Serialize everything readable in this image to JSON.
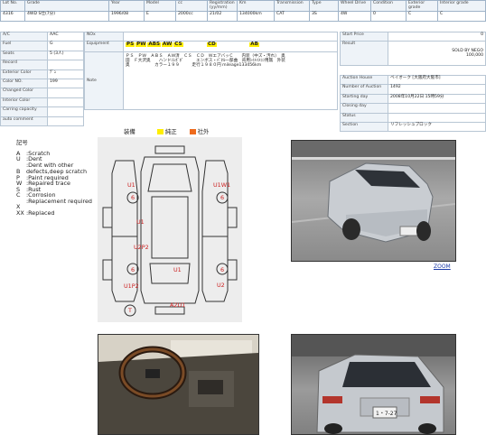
{
  "header": {
    "columns": [
      "Lot No.",
      "Grade",
      "Year",
      "Model",
      "cc",
      "Registration (yy/mm)",
      "Km",
      "Transmission",
      "Type",
      "Wheel Drive",
      "Condition",
      "Exterior grade",
      "Interior grade"
    ],
    "values": [
      "4316",
      "4WD S仕(7分)",
      "1996/08",
      "E",
      "2000cc",
      "21/02",
      "134000km",
      "CAT",
      "3S",
      "4W",
      "0",
      "C",
      "C"
    ]
  },
  "left_rows": [
    {
      "label": "A/C",
      "value": "AAC"
    },
    {
      "label": "Fuel",
      "value": "G"
    },
    {
      "label": "Seats",
      "value": "5 (3人)"
    },
    {
      "label": "Record",
      "value": ""
    },
    {
      "label": "Exterior Color",
      "value": "ﾃﾞｭ"
    },
    {
      "label": "Color NO.",
      "value": "199"
    },
    {
      "label": "Changed Color",
      "value": ""
    },
    {
      "label": "Interior Color",
      "value": ""
    },
    {
      "label": "Carring capacity",
      "value": ""
    },
    {
      "label": "auto comment",
      "value": ""
    }
  ],
  "mid": {
    "nox_label": "NOx",
    "equipment_label": "Equipment",
    "note_label": "Note",
    "equipment_tags": [
      "PS",
      "PW",
      "ABS",
      "AW",
      "CS",
      "CD",
      "AB"
    ],
    "equipment_text": "ＰＳ　ＰＷ　ＡＢＳ　ＡＷ済　ＣＳ　ＣＤ　ＷエアバッＣ　　内装（中ズ・汚れ）　奥",
    "note_line1": "田　Ｆ大沢奥　　ハンドルﾎﾞﾎﾞ　　　エンボス・ﾊﾟﾈﾙ一部曲　背用ｼｲﾒｲﾒｺﾝ用無　外装",
    "note_line2": "奥　　　　　　カラー１９９　　　走行１９８０円 mileage133456km"
  },
  "right_top": {
    "start_price_label": "Start Price",
    "start_price_value": "0",
    "result_label": "Result",
    "result_line1": "SOLD BY NEGO",
    "result_line2": "100,000"
  },
  "auction": [
    {
      "label": "Auction House",
      "value": "ベイオーク [大阪府大阪市]"
    },
    {
      "label": "Number of Auction",
      "value": "1492"
    },
    {
      "label": "Starting day",
      "value": "2008年10月22日 15時59分"
    },
    {
      "label": "Closing day",
      "value": ""
    },
    {
      "label": "Status",
      "value": ""
    },
    {
      "label": "Section",
      "value": "リフレッシュブロック"
    }
  ],
  "legend": {
    "title": "記号",
    "items": [
      {
        "code": "A",
        "text": ":Scratch"
      },
      {
        "code": "U",
        "text": ":Dent"
      },
      {
        "code": "B",
        "text": ":Dent with other defects,deep scratch"
      },
      {
        "code": "P",
        "text": ":Paint required"
      },
      {
        "code": "W",
        "text": ":Repaired trace"
      },
      {
        "code": "S",
        "text": ":Rust"
      },
      {
        "code": "C",
        "text": ":Corrosion"
      },
      {
        "code": "X",
        "text": ":Replacement required"
      },
      {
        "code": "XX",
        "text": ":Replaced"
      }
    ]
  },
  "diagram_legend": {
    "equip_label": "装備",
    "genuine_label": "純正",
    "aftermarket_label": "社外",
    "genuine_color": "#ffee00",
    "aftermarket_color": "#ee6a1c"
  },
  "damage_marks": [
    "U1",
    "U1W1",
    "6",
    "6",
    "U1",
    "U2P2",
    "6",
    "6",
    "U1",
    "U1P2",
    "U2",
    "T",
    "A2U1"
  ],
  "zoom_label": "ZOOM",
  "photo_plate": "1・7-27"
}
